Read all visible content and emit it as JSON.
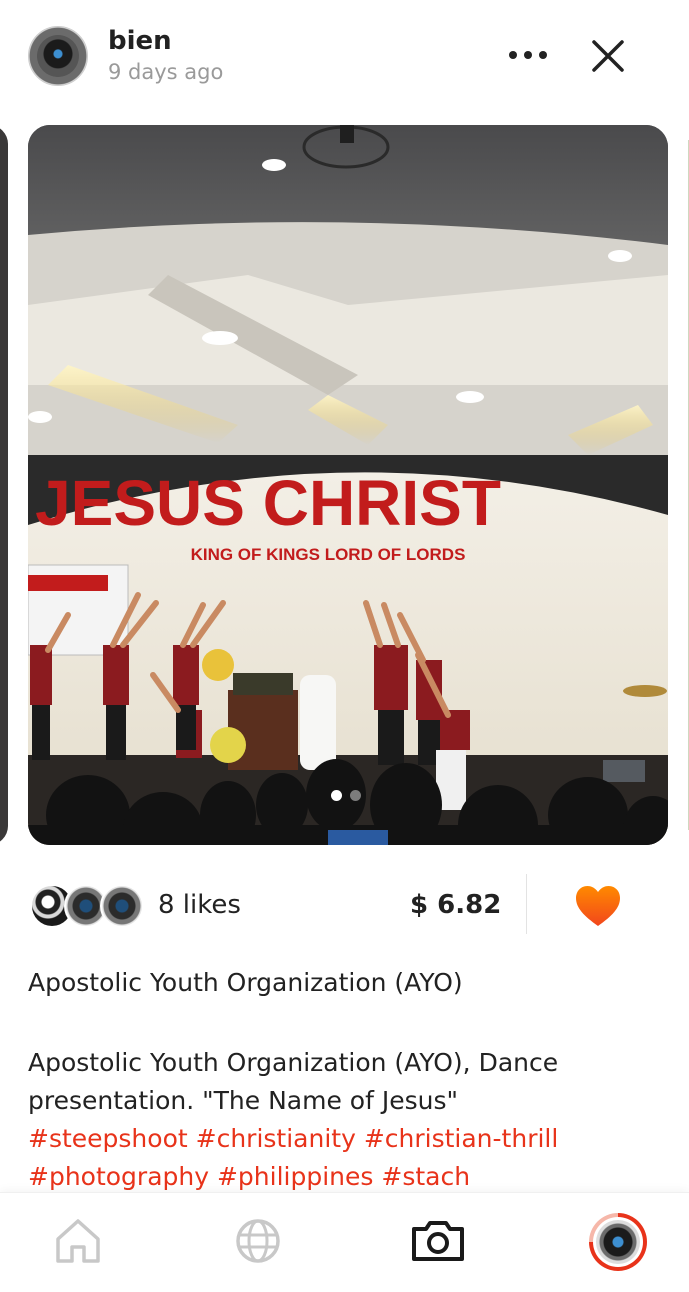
{
  "post": {
    "author": "bien",
    "posted_ago": "9 days ago",
    "carousel": {
      "current_index": 1,
      "total": 2
    }
  },
  "stats": {
    "likes_label": "8 likes",
    "payout_label": "$ 6.82"
  },
  "content": {
    "title": "Apostolic Youth Organization (AYO)",
    "body_line": "Apostolic Youth Organization (AYO), Dance presentation. \"The Name of Jesus\"",
    "hashtags": [
      "#steepshoot",
      "#christianity",
      "#christian-thrill",
      "#photography",
      "#philippines",
      "#stach"
    ]
  },
  "photo": {
    "banner_main": "JESUS CHRIST",
    "banner_sub": "KING OF KINGS LORD OF LORDS"
  },
  "icons": {
    "more": "more-dots-icon",
    "close": "close-icon",
    "heart": "heart-icon",
    "home": "home-icon",
    "explore": "globe-icon",
    "camera": "camera-icon",
    "profile": "profile-avatar"
  },
  "colors": {
    "accent": "#e8331a",
    "heart_top": "#ff8a00",
    "heart_bottom": "#f2461c",
    "muted": "#9a9a9a"
  }
}
